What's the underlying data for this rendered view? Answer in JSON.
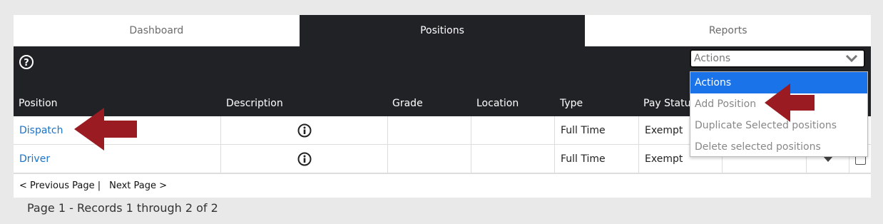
{
  "tabs": [
    {
      "label": "Dashboard"
    },
    {
      "label": "Positions"
    },
    {
      "label": "Reports"
    }
  ],
  "toolbar": {
    "help_icon": "help-icon",
    "actions_label": "Actions"
  },
  "table": {
    "columns": [
      "Position",
      "Description",
      "Grade",
      "Location",
      "Type",
      "Pay Status"
    ],
    "rows": [
      {
        "position": "Dispatch",
        "description_icon": "info-icon",
        "grade": "",
        "location": "",
        "type": "Full Time",
        "pay_status": "Exempt"
      },
      {
        "position": "Driver",
        "description_icon": "info-icon",
        "grade": "",
        "location": "",
        "type": "Full Time",
        "pay_status": "Exempt"
      }
    ]
  },
  "pager": {
    "previous": "< Previous Page |",
    "next": "Next Page >",
    "records": "Page 1 - Records 1 through 2 of 2"
  },
  "actions_menu": {
    "items": [
      "Actions",
      "Add Position",
      "Duplicate Selected positions",
      "Delete selected positions"
    ]
  },
  "colors": {
    "dark_bg": "#202226",
    "link": "#1a73c8",
    "selected": "#1a73e8",
    "arrow": "#9b1b22"
  }
}
